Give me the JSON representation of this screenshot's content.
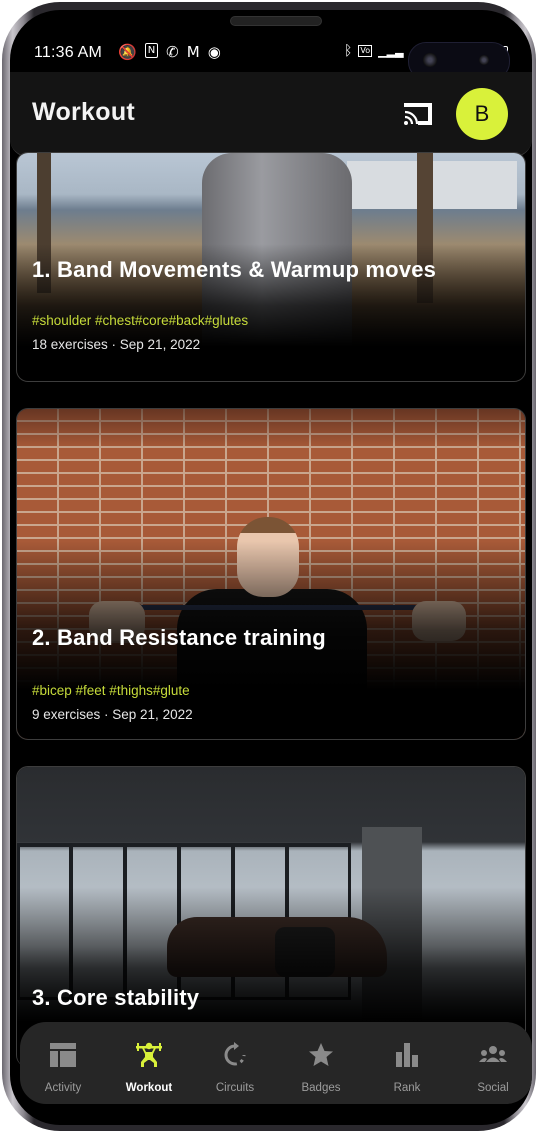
{
  "status_bar": {
    "time": "11:36 AM",
    "left_icons": [
      "notification-off-icon",
      "nfc-icon",
      "missed-call-icon",
      "gmail-icon",
      "chrome-icon"
    ],
    "right_icons": [
      "bluetooth-icon",
      "volte-icon",
      "signal-icon",
      "battery-icon"
    ]
  },
  "app_bar": {
    "title": "Workout",
    "avatar_initial": "B",
    "accent_color": "#d9f13a"
  },
  "workouts": [
    {
      "title": "1. Band Movements & Warmup moves",
      "tags": "#shoulder #chest#core#back#glutes",
      "meta": "18 exercises · Sep 21, 2022"
    },
    {
      "title": "2. Band Resistance training",
      "tags": "#bicep #feet  #thighs#glute",
      "meta": "9 exercises · Sep 21, 2022"
    },
    {
      "title": "3. Core stability"
    }
  ],
  "bottom_nav": {
    "active": "Workout",
    "items": [
      {
        "label": "Activity",
        "icon": "dashboard-icon"
      },
      {
        "label": "Workout",
        "icon": "weightlifter-icon"
      },
      {
        "label": "Circuits",
        "icon": "refresh-circle-icon"
      },
      {
        "label": "Badges",
        "icon": "star-icon"
      },
      {
        "label": "Rank",
        "icon": "bar-chart-icon"
      },
      {
        "label": "Social",
        "icon": "group-icon"
      }
    ]
  }
}
